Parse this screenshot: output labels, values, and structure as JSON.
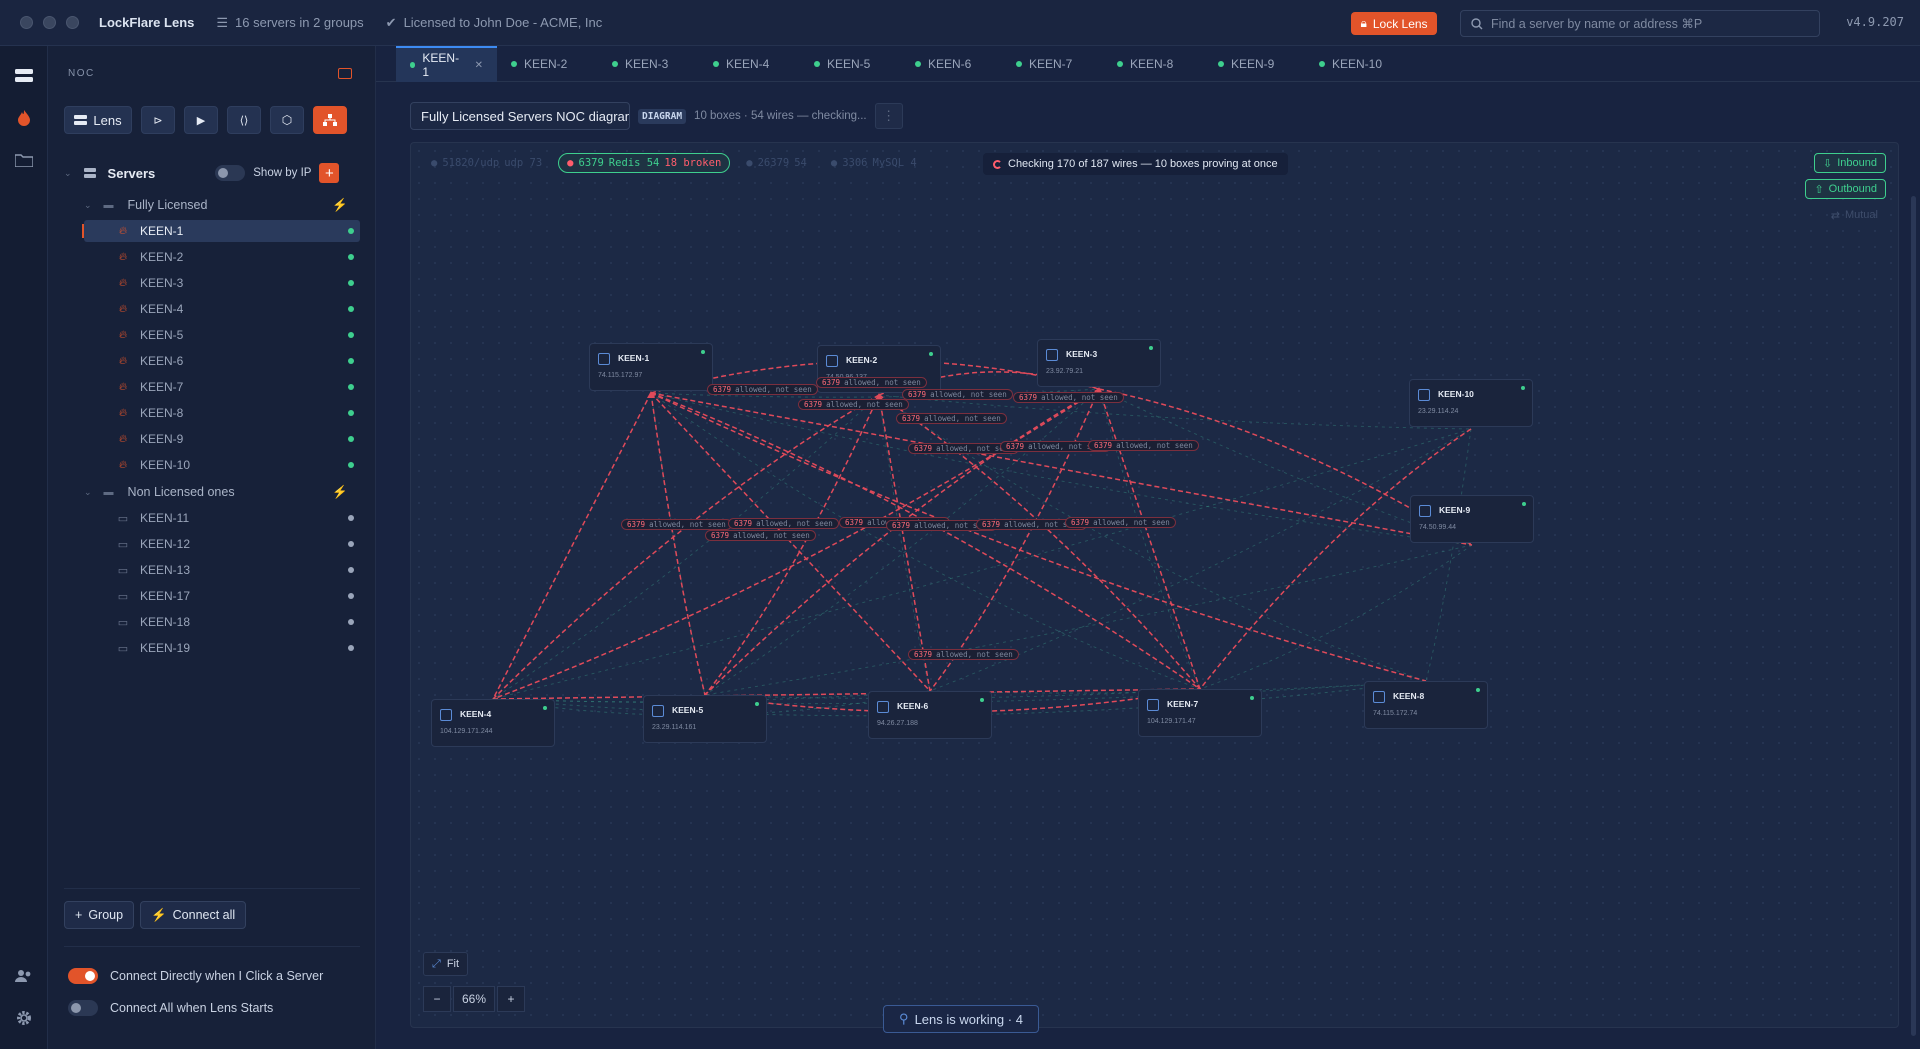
{
  "app": {
    "title": "LockFlare Lens",
    "servers_meta": "16 servers in 2 groups",
    "license": "Licensed to John Doe - ACME, Inc",
    "lock_label": "Lock Lens",
    "search_placeholder": "Find a server by name or address ⌘P",
    "version": "v4.9.207"
  },
  "sidebar": {
    "section": "NOC",
    "tool_lens": "Lens",
    "servers_label": "Servers",
    "show_by_ip": "Show by IP",
    "groups": [
      {
        "name": "Fully Licensed",
        "servers": [
          "KEEN-1",
          "KEEN-2",
          "KEEN-3",
          "KEEN-4",
          "KEEN-5",
          "KEEN-6",
          "KEEN-7",
          "KEEN-8",
          "KEEN-9",
          "KEEN-10"
        ]
      },
      {
        "name": "Non Licensed ones",
        "servers": [
          "KEEN-11",
          "KEEN-12",
          "KEEN-13",
          "KEEN-17",
          "KEEN-18",
          "KEEN-19"
        ]
      }
    ],
    "group_button": "Group",
    "connect_all_button": "Connect all",
    "opt_connect_click": "Connect Directly when I Click a Server",
    "opt_connect_start": "Connect All when Lens Starts"
  },
  "tabs": [
    "KEEN-1",
    "KEEN-2",
    "KEEN-3",
    "KEEN-4",
    "KEEN-5",
    "KEEN-6",
    "KEEN-7",
    "KEEN-8",
    "KEEN-9",
    "KEEN-10"
  ],
  "diagram": {
    "name_value": "Fully Licensed Servers NOC diagram",
    "badge": "DIAGRAM",
    "meta": "10 boxes · 54 wires — checking...",
    "chips": [
      {
        "port": "51820/udp",
        "text": "udp 73"
      },
      {
        "port": "6379",
        "text": "Redis 54",
        "broken": "18 broken"
      },
      {
        "port": "26379",
        "text": "54"
      },
      {
        "port": "3306",
        "text": "MySQL 4"
      }
    ],
    "checking": "Checking 170 of 187 wires — 10 boxes proving at once",
    "inbound": "Inbound",
    "outbound": "Outbound",
    "mutual": "Mutual",
    "nodes": [
      {
        "name": "KEEN-1",
        "ip": "74.115.172.97"
      },
      {
        "name": "KEEN-2",
        "ip": "74.50.96.137"
      },
      {
        "name": "KEEN-3",
        "ip": "23.92.79.21"
      },
      {
        "name": "KEEN-10",
        "ip": "23.29.114.24"
      },
      {
        "name": "KEEN-9",
        "ip": "74.50.99.44"
      },
      {
        "name": "KEEN-4",
        "ip": "104.129.171.244"
      },
      {
        "name": "KEEN-5",
        "ip": "23.29.114.161"
      },
      {
        "name": "KEEN-6",
        "ip": "94.26.27.188"
      },
      {
        "name": "KEEN-7",
        "ip": "104.129.171.47"
      },
      {
        "name": "KEEN-8",
        "ip": "74.115.172.74"
      }
    ],
    "wire_port": "6379",
    "wire_status": "allowed, not seen",
    "fit": "Fit",
    "zoom": "66%",
    "working": "Lens is working · 4"
  }
}
